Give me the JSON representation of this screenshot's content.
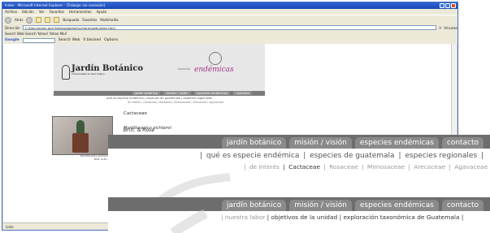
{
  "ie": {
    "title": "Index - Microsoft Internet Explorer - [Trabajar sin conexión]",
    "menu": [
      "Archivo",
      "Edición",
      "Ver",
      "Favoritos",
      "Herramientas",
      "Ayuda"
    ],
    "back_label": "Atrás",
    "search_label": "Búsqueda",
    "favorites_label": "Favoritos",
    "multimedia_label": "Multimedia",
    "address_label": "Dirección",
    "address_value": "C:\\Documents and Settings\\bela\\Escritorio\\web\\index.html",
    "go_label": "Ir",
    "links_label": "Vínculos",
    "links_bar": "Search   Web Search   Yahoo!   Yahoo   Mail",
    "google": {
      "brand": "Google",
      "search_web": "Search Web",
      "blocked": "0 blocked",
      "options": "Options"
    },
    "status": "Listo"
  },
  "site": {
    "logo_title": "Jardín Botánico",
    "logo_sub": "Universidad de San Carlos",
    "especies_small": "especies",
    "especies_big": "endémicas",
    "photo_caption_1": "Myrtillocactus eichlamii",
    "photo_caption_2": "Britt. & Ro..."
  },
  "nav": {
    "tabs": [
      "jardín botánico",
      "misión / visión",
      "especies endémicas",
      "contacto"
    ]
  },
  "subnav": {
    "items": [
      "qué es especie endémica",
      "especies de guatemala",
      "especies regionales"
    ],
    "sep": "|"
  },
  "families": {
    "items": [
      "de interés",
      "Cactaceae",
      "Rosaceae",
      "Mimosaceae",
      "Arecaceae",
      "Agavaceae"
    ]
  },
  "content": {
    "heading": "Cactaceae",
    "species": "Myrtillocactus eichlamii",
    "species_author": "Britt. & Rose"
  },
  "subnav2": {
    "items": [
      "nuestra labor",
      "objetivos de la unidad",
      "exploración taxonómica de Guatemala"
    ]
  }
}
